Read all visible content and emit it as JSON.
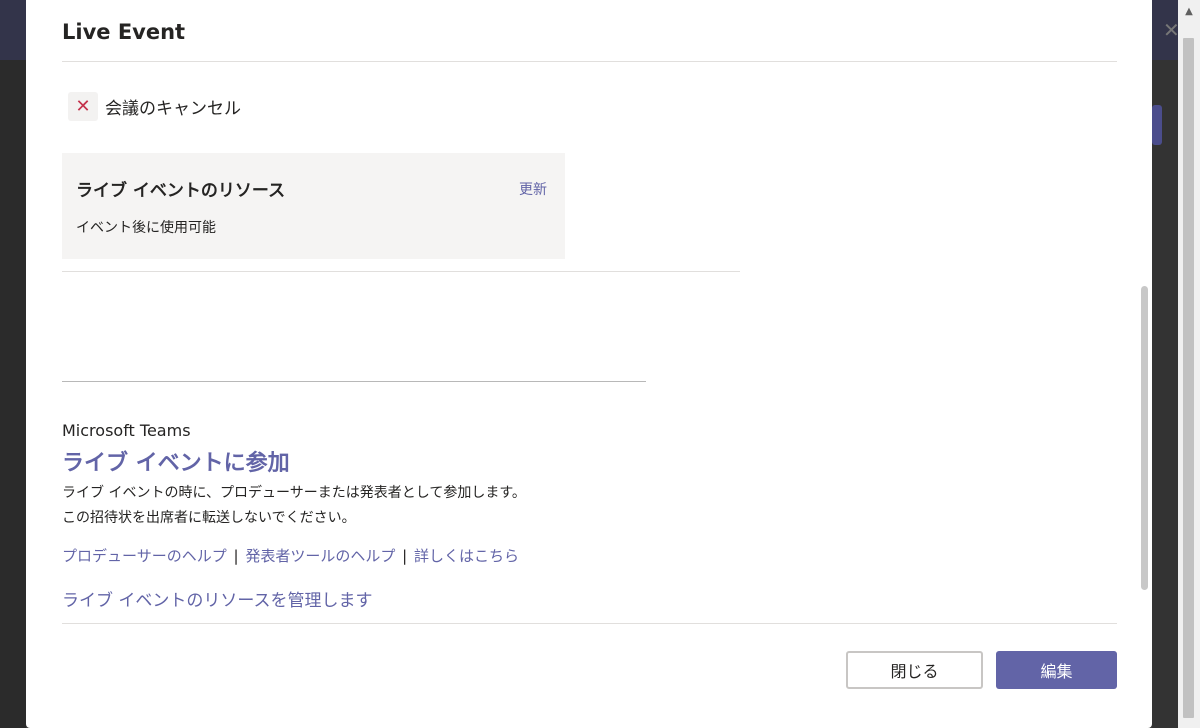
{
  "modal": {
    "title": "Live Event",
    "cancel_meeting_label": "会議のキャンセル",
    "resources_card": {
      "title": "ライブ イベントのリソース",
      "update_link": "更新",
      "subtitle": "イベント後に使用可能"
    },
    "brand": "Microsoft Teams",
    "join_link": "ライブ イベントに参加",
    "description_line1": "ライブ イベントの時に、プロデューサーまたは発表者として参加します。",
    "description_line2": "この招待状を出席者に転送しないでください。",
    "help_links": {
      "producer_help": "プロデューサーのヘルプ",
      "separator": "|",
      "presenter_tool_help": "発表者ツールのヘルプ",
      "learn_more": "詳しくはこちら"
    },
    "manage_resources_link": "ライブ イベントのリソースを管理します",
    "buttons": {
      "close": "閉じる",
      "edit": "編集"
    }
  },
  "icons": {
    "cancel": "close-x-icon",
    "scroll_up": "scroll-up-arrow-icon"
  },
  "colors": {
    "accent": "#6264a7",
    "cancel_icon": "#c4314b"
  }
}
